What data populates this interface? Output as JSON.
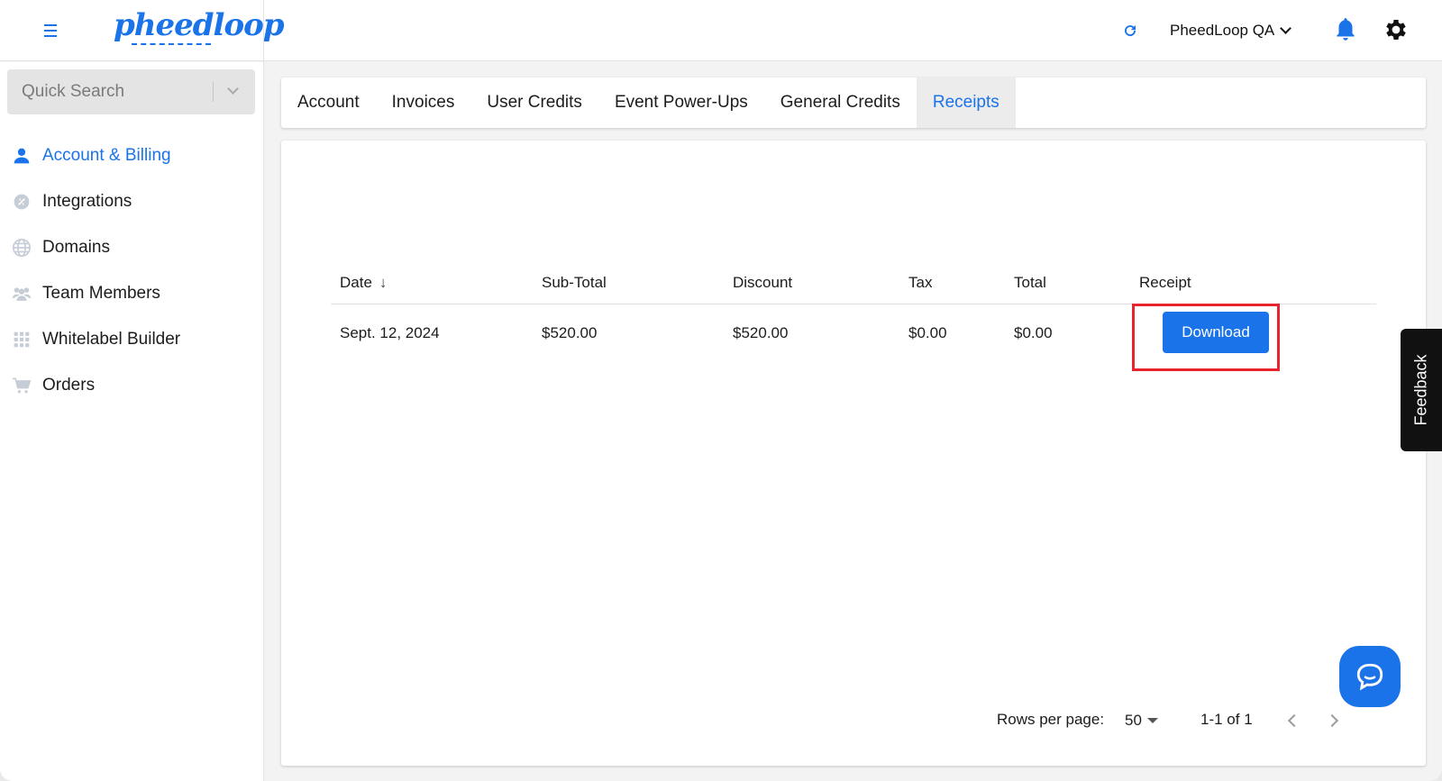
{
  "header": {
    "logo_text": "pheedloop",
    "account_name": "PheedLoop QA"
  },
  "sidebar": {
    "search_placeholder": "Quick Search",
    "items": [
      {
        "label": "Account & Billing",
        "icon": "person-icon",
        "active": true
      },
      {
        "label": "Integrations",
        "icon": "integrations-icon",
        "active": false
      },
      {
        "label": "Domains",
        "icon": "globe-icon",
        "active": false
      },
      {
        "label": "Team Members",
        "icon": "team-icon",
        "active": false
      },
      {
        "label": "Whitelabel Builder",
        "icon": "grid-icon",
        "active": false
      },
      {
        "label": "Orders",
        "icon": "cart-icon",
        "active": false
      }
    ]
  },
  "tabs": [
    {
      "label": "Account",
      "active": false
    },
    {
      "label": "Invoices",
      "active": false
    },
    {
      "label": "User Credits",
      "active": false
    },
    {
      "label": "Event Power-Ups",
      "active": false
    },
    {
      "label": "General Credits",
      "active": false
    },
    {
      "label": "Receipts",
      "active": true
    }
  ],
  "table": {
    "columns": [
      "Date",
      "Sub-Total",
      "Discount",
      "Tax",
      "Total",
      "Receipt"
    ],
    "sort_column": "Date",
    "sort_direction": "descending",
    "rows": [
      {
        "date": "Sept. 12, 2024",
        "subtotal": "$520.00",
        "discount": "$520.00",
        "tax": "$0.00",
        "total": "$0.00",
        "action": "Download"
      }
    ]
  },
  "pagination": {
    "rows_per_page_label": "Rows per page:",
    "rows_per_page": "50",
    "range": "1-1 of 1"
  },
  "feedback_label": "Feedback",
  "colors": {
    "accent": "#1a73e8",
    "highlight": "#e8252f"
  }
}
